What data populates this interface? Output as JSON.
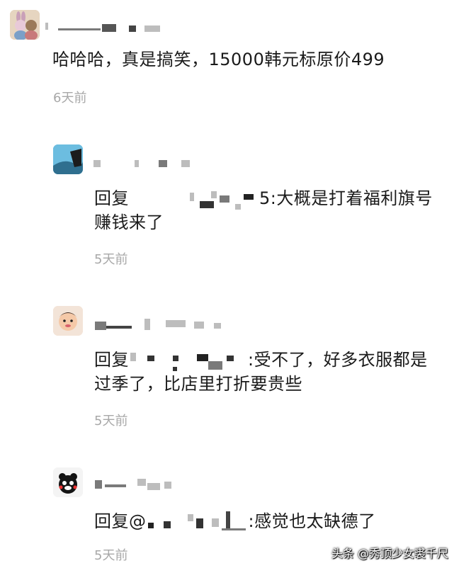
{
  "main_comment": {
    "text": "哈哈哈，真是搞笑，15000韩元标原价499",
    "time": "6天前"
  },
  "replies": [
    {
      "prefix": "回复",
      "suffix": "5:大概是打着福利旗号",
      "line2": "赚钱来了",
      "time": "5天前"
    },
    {
      "prefix": "回复",
      "suffix": ":受不了，好多衣服都是",
      "line2": "过季了，比店里打折要贵些",
      "time": "5天前"
    },
    {
      "prefix": "回复@",
      "suffix": ":感觉也太缺德了",
      "time": "5天前"
    }
  ],
  "watermark": "头条 @秀顶少女裘千尺"
}
